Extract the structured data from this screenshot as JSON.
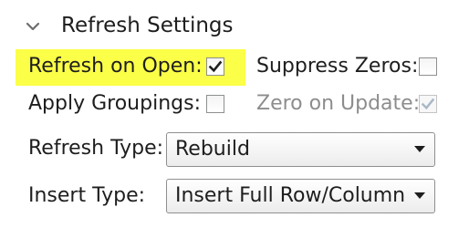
{
  "section": {
    "title": "Refresh Settings",
    "toggle_icon": "chevron-down-icon",
    "expanded": true
  },
  "options": {
    "refresh_on_open": {
      "label": "Refresh on Open:",
      "checked": true,
      "enabled": true,
      "highlighted": true
    },
    "suppress_zeros": {
      "label": "Suppress Zeros:",
      "checked": false,
      "enabled": true
    },
    "apply_groupings": {
      "label": "Apply Groupings:",
      "checked": false,
      "enabled": true
    },
    "zero_on_update": {
      "label": "Zero on Update:",
      "checked": true,
      "enabled": false
    }
  },
  "refresh_type": {
    "label": "Refresh Type:",
    "value": "Rebuild"
  },
  "insert_type": {
    "label": "Insert Type:",
    "value": "Insert Full Row/Column"
  },
  "colors": {
    "highlight": "#fbff47",
    "text": "#1e1e1e",
    "disabled_text": "#8d8d8d",
    "checkmark": "#1f1f1f",
    "disabled_checkmark": "#a9b7c6"
  }
}
